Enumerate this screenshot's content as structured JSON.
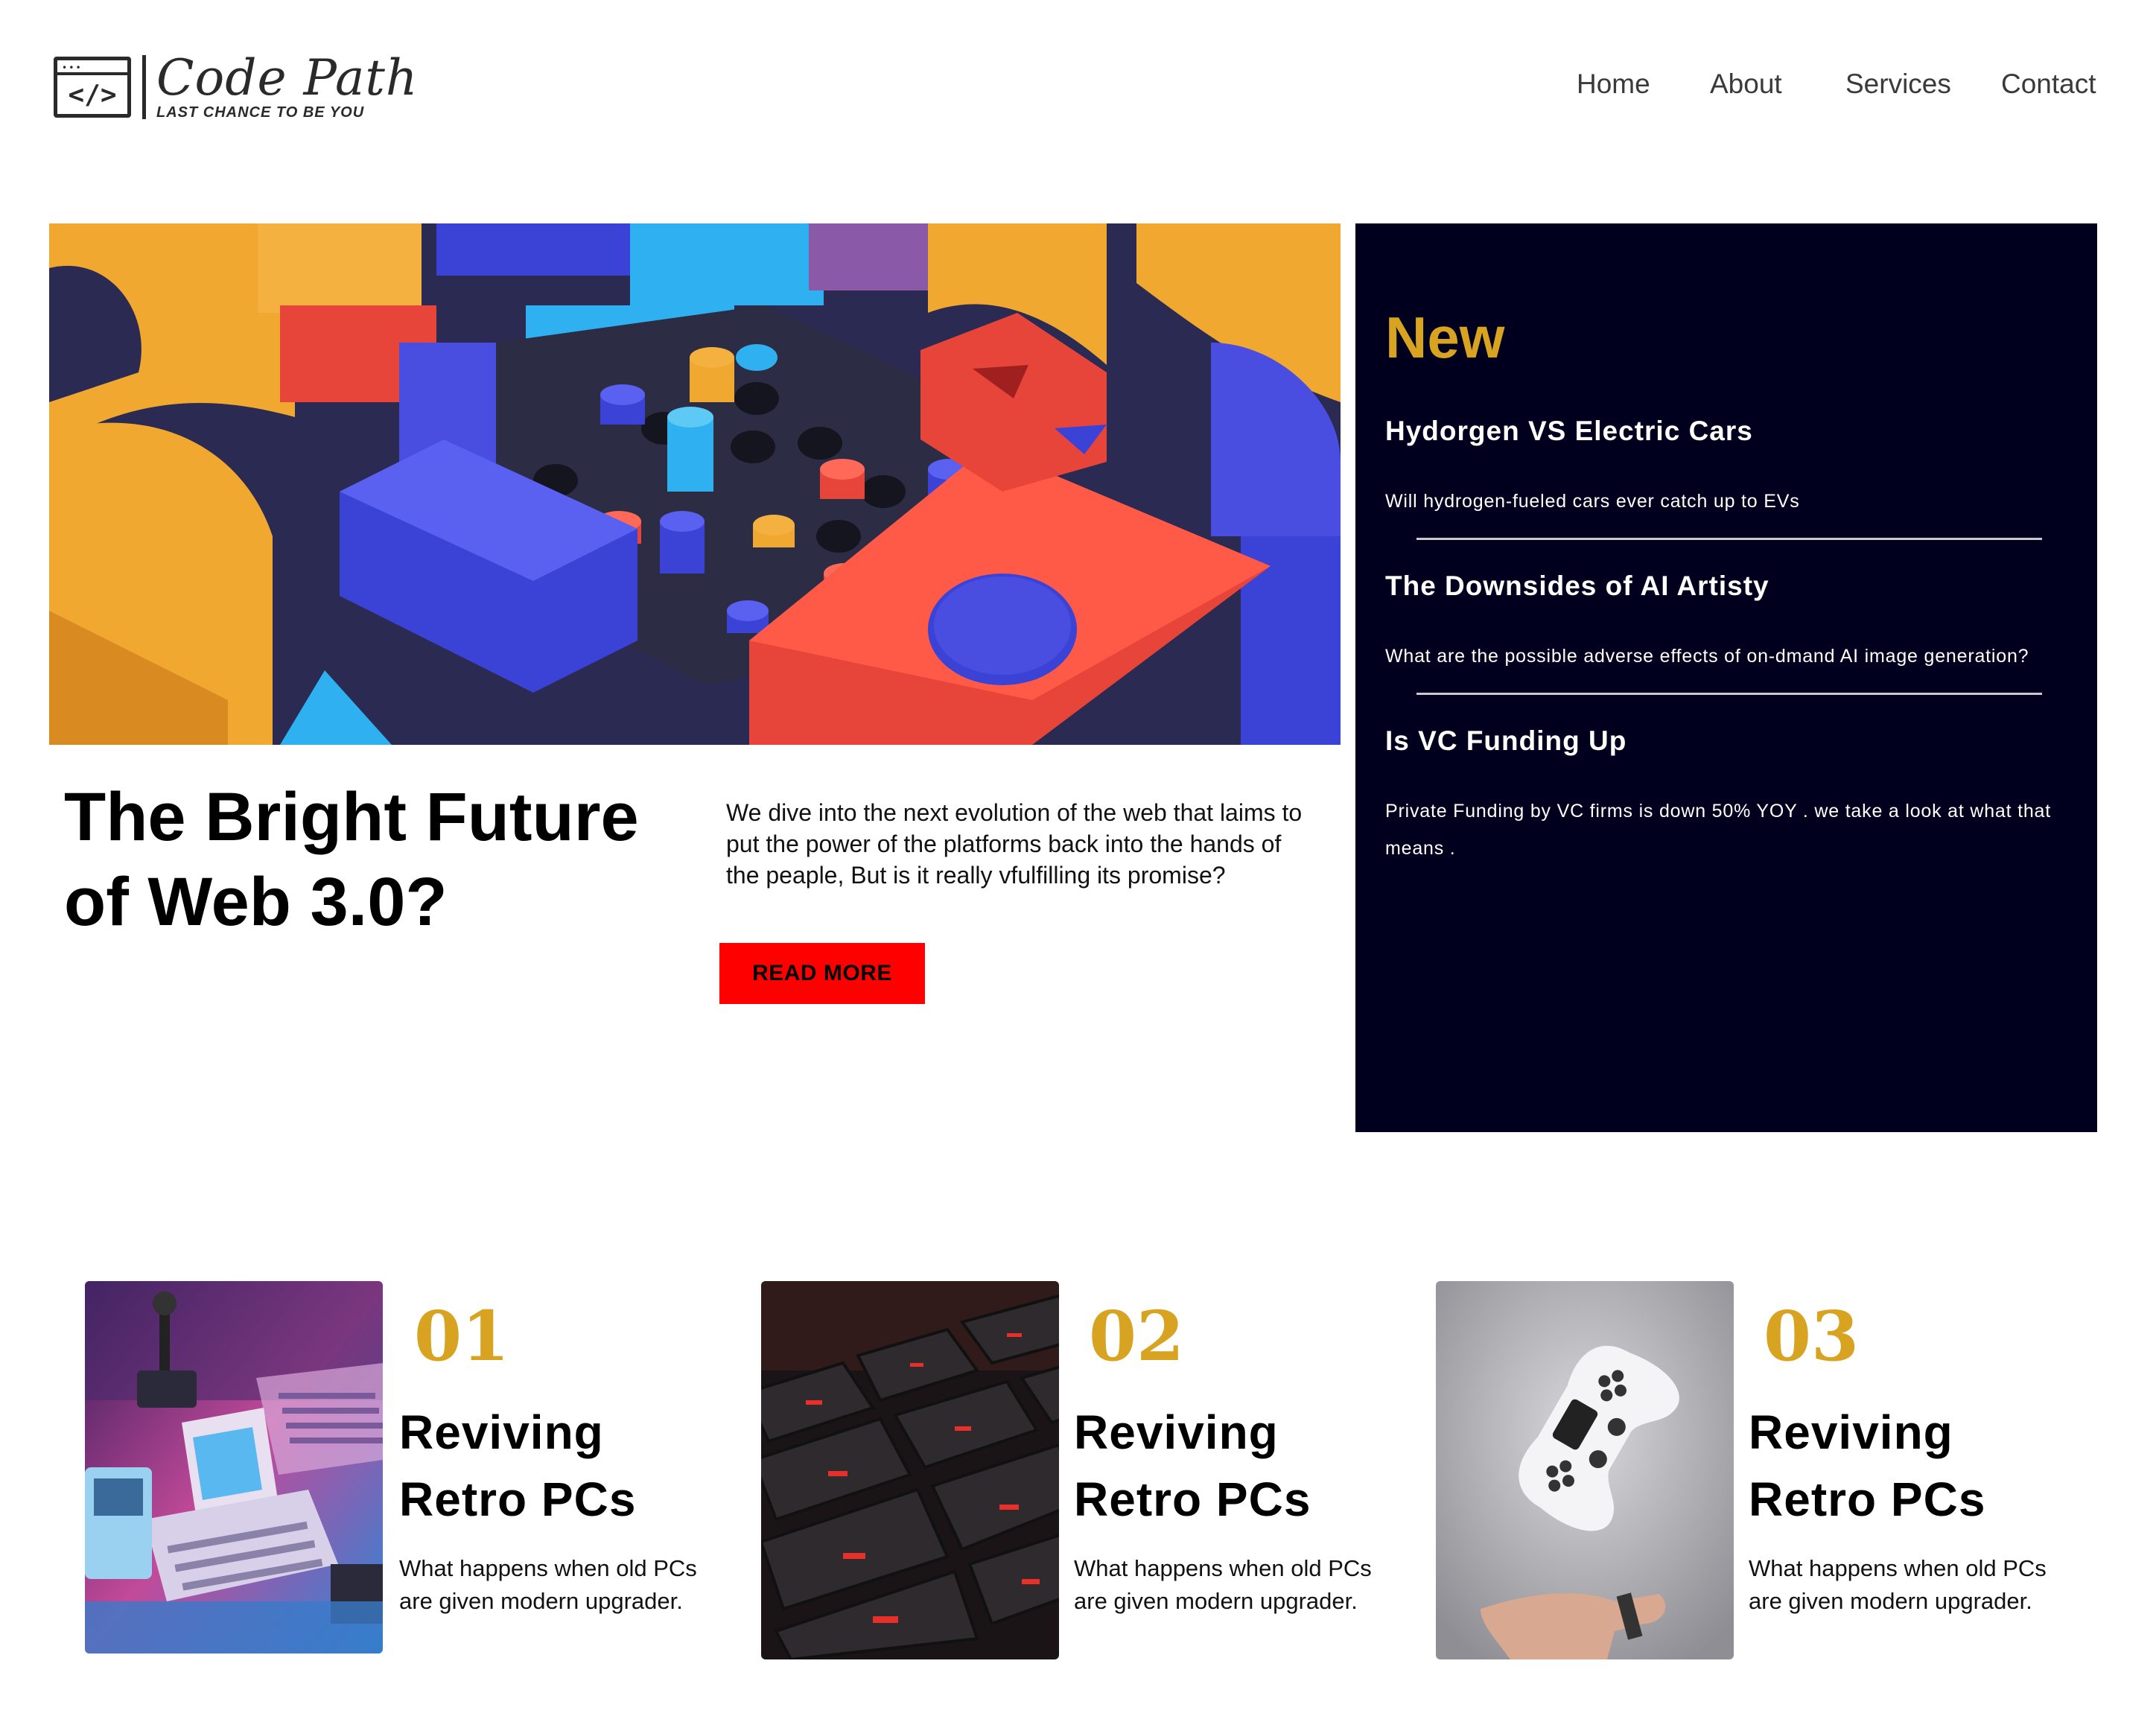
{
  "brand": {
    "name": "Code Path",
    "tagline": "LAST CHANCE TO BE YOU",
    "icon": "code-window-icon"
  },
  "nav": {
    "items": [
      "Home",
      "About",
      "Services",
      "Contact"
    ]
  },
  "hero": {
    "image": "colorful-3d-blocks-image",
    "title": "The Bright Future of Web 3.0?",
    "description": "We dive into the next evolution of the web that laims to put the power of the platforms back into the hands of the peaple, But is it really vfulfilling its promise?",
    "button": "READ MORE"
  },
  "sidebar": {
    "heading": "New",
    "items": [
      {
        "title": "Hydorgen VS Electric Cars",
        "desc": "Will hydrogen-fueled cars ever catch up to EVs"
      },
      {
        "title": "The Downsides of AI Artisty",
        "desc": "What are the possible adverse effects of on-dmand AI image generation?"
      },
      {
        "title": "Is VC Funding Up",
        "desc": "Private Funding by VC firms is down 50% YOY . we take a look at what that means ."
      }
    ]
  },
  "cards": [
    {
      "num": "01",
      "title": "Reviving Retro PCs",
      "desc": "What happens when old PCs are given modern upgrader.",
      "image": "retro-computer-image"
    },
    {
      "num": "02",
      "title": "Reviving Retro PCs",
      "desc": "What happens when old PCs are given modern upgrader.",
      "image": "red-backlit-keyboard-image"
    },
    {
      "num": "03",
      "title": "Reviving Retro PCs",
      "desc": "What happens when old PCs are given modern upgrader.",
      "image": "floating-gamepad-image"
    }
  ],
  "colors": {
    "accent": "#d9a322",
    "sidebar_bg": "#00001e",
    "button": "#ff0000"
  }
}
